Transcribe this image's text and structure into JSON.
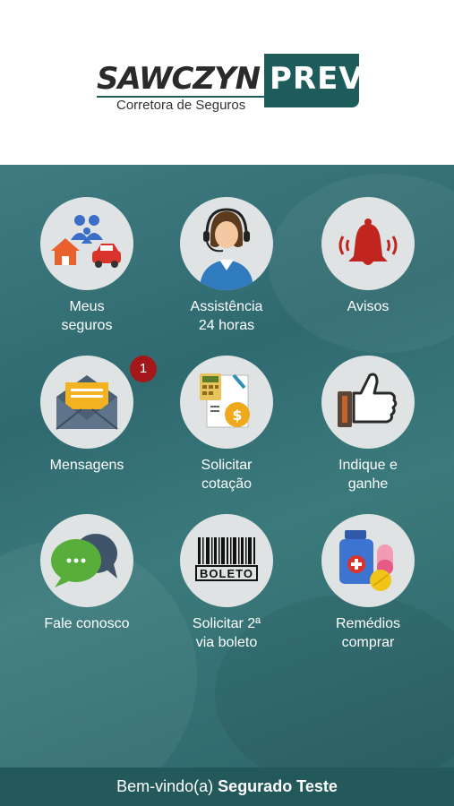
{
  "header": {
    "logo_main": "SAWCZYN",
    "logo_accent": "PREV",
    "logo_sub": "Corretora de Seguros"
  },
  "tiles": [
    {
      "label": "Meus\nseguros",
      "icon": "family-house-car-icon"
    },
    {
      "label": "Assistência\n24 horas",
      "icon": "support-agent-icon"
    },
    {
      "label": "Avisos",
      "icon": "alarm-bell-icon"
    },
    {
      "label": "Mensagens",
      "icon": "envelope-icon",
      "badge": "1"
    },
    {
      "label": "Solicitar\ncotação",
      "icon": "calculator-document-icon"
    },
    {
      "label": "Indique e\nganhe",
      "icon": "thumbs-up-icon"
    },
    {
      "label": "Fale conosco",
      "icon": "chat-bubbles-icon"
    },
    {
      "label": "Solicitar 2ª\nvia boleto",
      "icon": "barcode-boleto-icon",
      "boleto_text": "BOLETO"
    },
    {
      "label": "Remédios\ncomprar",
      "icon": "medicine-icon"
    }
  ],
  "footer": {
    "greeting": "Bem-vindo(a)",
    "user_name": "Segurado Teste"
  },
  "colors": {
    "brand": "#1d5c5a",
    "background": "#3a7579",
    "footer": "#24595c",
    "badge": "#a31818"
  }
}
